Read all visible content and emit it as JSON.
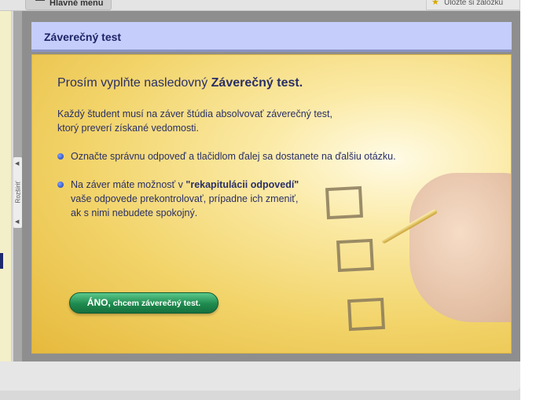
{
  "topbar": {
    "menu_label": "Hlavné menu",
    "bookmark_label": "Uložte si záložku"
  },
  "sidebar": {
    "expand_label": "Rozšíriť"
  },
  "panel": {
    "title": "Záverečný test",
    "heading_prefix": "Prosím vyplňte nasledovný ",
    "heading_bold": "Záverečný test.",
    "intro_line1": "Každý študent musí na záver štúdia absolvovať záverečný test,",
    "intro_line2": "ktorý preverí získané vedomosti.",
    "bullet1": "Označte správnu odpoveď a tlačidlom ďalej sa dostanete na ďalšiu otázku.",
    "bullet2_prefix": "Na záver máte možnosť v ",
    "bullet2_bold": "\"rekapitulácii odpovedí\"",
    "bullet2_line2": "vaše odpovede prekontrolovať, prípadne ich zmeniť,",
    "bullet2_line3": "ak s nimi nebudete spokojný.",
    "button_bold": "ÁNO,",
    "button_rest": " chcem záverečný test."
  }
}
